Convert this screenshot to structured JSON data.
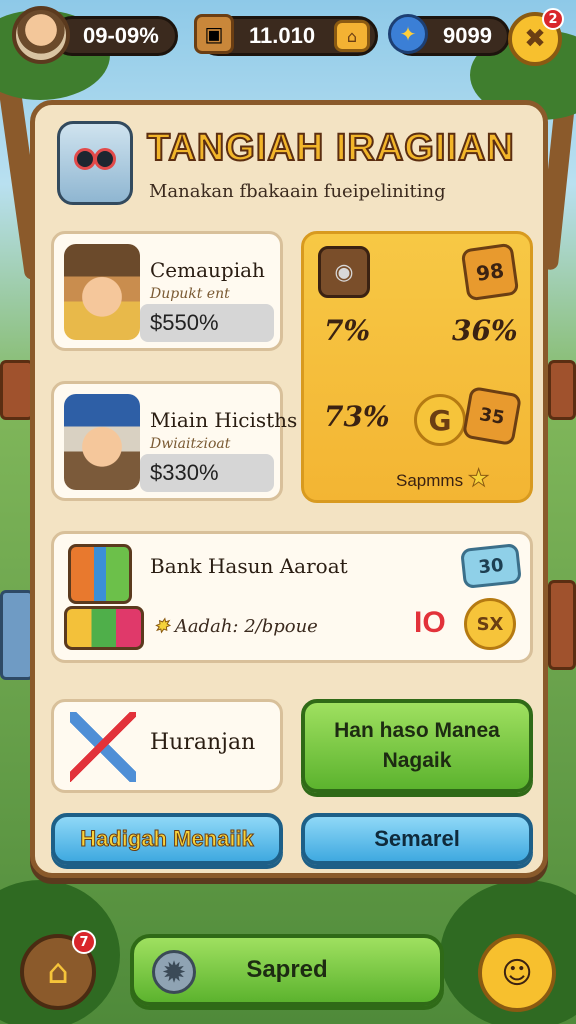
{
  "hud": {
    "level_text": "09-09%",
    "gold_text": "11.010",
    "gems_text": "9099",
    "close_badge": "2"
  },
  "panel": {
    "title": "TANGIAH IRAGIIAN",
    "subtitle": "Manakan fbakaain fueipeliniting"
  },
  "characters": [
    {
      "name": "Cemaupiah",
      "subtitle": "Dupukt ent",
      "value": "$550%"
    },
    {
      "name": "Miain Hicisths",
      "subtitle": "Dwiaitzioat",
      "value": "$330%"
    }
  ],
  "bonus": {
    "ticket_text": "98",
    "values": [
      "7%",
      "36%",
      "73%"
    ],
    "ticket2_text": "35",
    "coin_text": "G",
    "footer": "Sapmms"
  },
  "bank": {
    "title": "Bank Hasun Aaroat",
    "subtitle": "Aadah: 2/bpoue",
    "tag_text": "30",
    "heart_text": "IO",
    "coin_text": "SX"
  },
  "tool": {
    "label": "Huranjan"
  },
  "buttons": {
    "green_label": "Han haso Manea Nagaik",
    "reward_label": "Hadigah Menaiik",
    "cancel_label": "Semarel",
    "save_label": "Sapred"
  },
  "bottom": {
    "home_badge": "7"
  },
  "icons": {
    "avatar": "player-avatar",
    "gold": "chest-icon",
    "gems": "gem-icon",
    "shop": "shop-icon",
    "close": "close-icon",
    "home": "home-icon",
    "gear": "gear-icon",
    "chat": "chat-icon"
  },
  "colors": {
    "panel_bg": "#f3e3c3",
    "title_gold": "#f2b62a",
    "green_button": "#5cb32e",
    "blue_button": "#3fa9e0",
    "bonus_card": "#f3b533"
  }
}
